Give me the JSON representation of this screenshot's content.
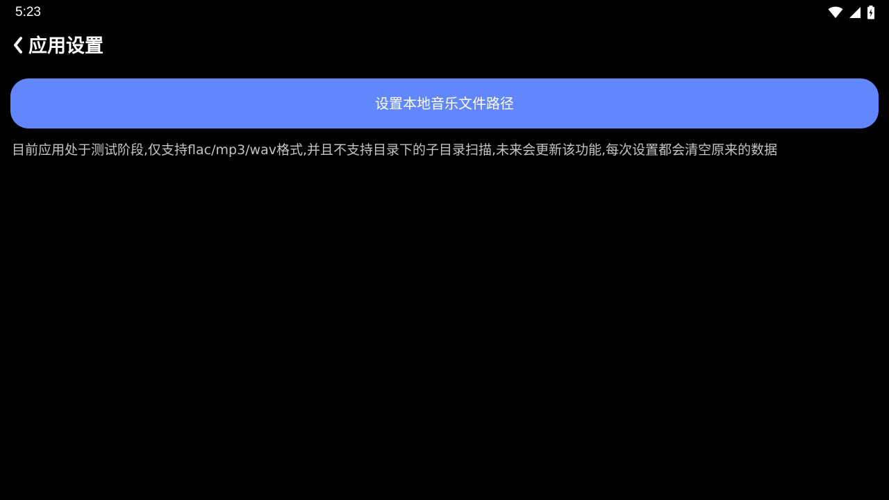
{
  "status_bar": {
    "time": "5:23",
    "icons": [
      "wifi-icon",
      "cell-signal-icon",
      "battery-charging-icon"
    ]
  },
  "header": {
    "back_icon": "chevron-left-icon",
    "title": "应用设置"
  },
  "main": {
    "set_path_button_label": "设置本地音乐文件路径",
    "description": "目前应用处于测试阶段,仅支持flac/mp3/wav格式,并且不支持目录下的子目录扫描,未来会更新该功能,每次设置都会清空原来的数据"
  },
  "colors": {
    "background": "#000000",
    "accent": "#6287fc",
    "text_primary": "#ffffff",
    "text_secondary": "#c4c4c4"
  }
}
